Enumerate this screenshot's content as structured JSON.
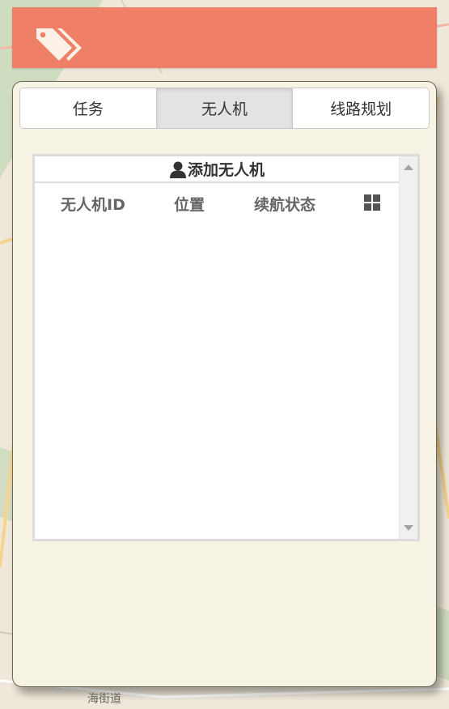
{
  "header": {
    "icon": "tags-icon",
    "color": "#ef7f67"
  },
  "tabs": [
    {
      "label": "任务",
      "active": false
    },
    {
      "label": "无人机",
      "active": true
    },
    {
      "label": "线路规划",
      "active": false
    }
  ],
  "drone_list": {
    "add_label": "添加无人机",
    "add_icon": "user-icon",
    "columns": [
      "无人机ID",
      "位置",
      "续航状态"
    ],
    "column_menu_icon": "grid-icon",
    "rows": []
  },
  "map": {
    "street_label": "海街道"
  }
}
